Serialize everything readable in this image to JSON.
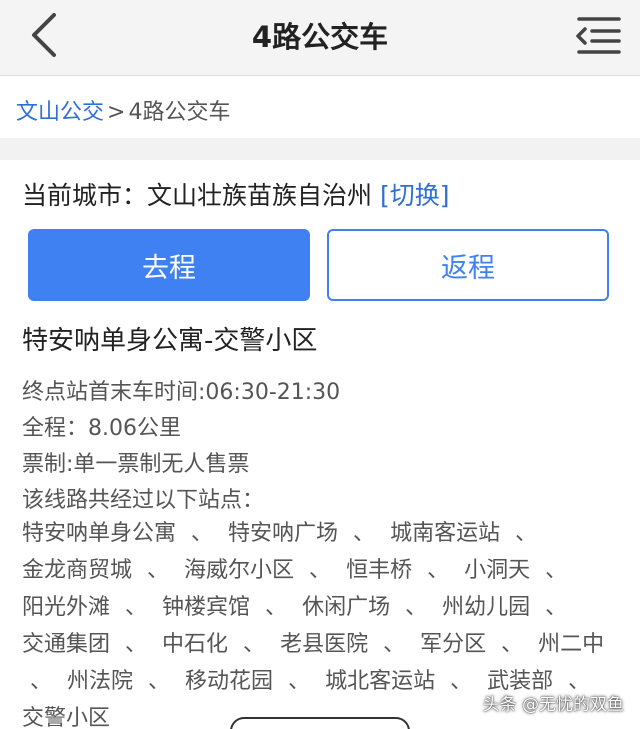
{
  "header": {
    "title": "4路公交车",
    "back_icon": "chevron-left-icon",
    "menu_icon": "list-menu-icon"
  },
  "breadcrumb": {
    "home": "文山公交",
    "separator": ">",
    "current": "4路公交车"
  },
  "city": {
    "label": "当前城市：",
    "name": "文山壮族苗族自治州",
    "switch_label": "[切换]"
  },
  "direction": {
    "go_label": "去程",
    "return_label": "返程",
    "active": "去程"
  },
  "route": {
    "name": "特安呐单身公寓-交警小区",
    "hours": "终点站首末车时间:06:30-21:30",
    "distance": "全程：8.06公里",
    "fare": "票制:单一票制无人售票",
    "stops_heading": "该线路共经过以下站点：",
    "stops": [
      "特安呐单身公寓",
      "特安呐广场",
      "城南客运站",
      "金龙商贸城",
      "海威尔小区",
      "恒丰桥",
      "小洞天",
      "阳光外滩",
      "钟楼宾馆",
      "休闲广场",
      "州幼儿园",
      "交通集团",
      "中石化",
      "老县医院",
      "军分区",
      "州二中",
      "州法院",
      "移动花园",
      "城北客运站",
      "武装部",
      "交警小区"
    ],
    "stop_separator": "、"
  },
  "watermark": "头条 @无忧的双鱼",
  "colors": {
    "accent": "#3f80f2",
    "link": "#2f6fd6",
    "header_bg": "#f4f4f4"
  }
}
